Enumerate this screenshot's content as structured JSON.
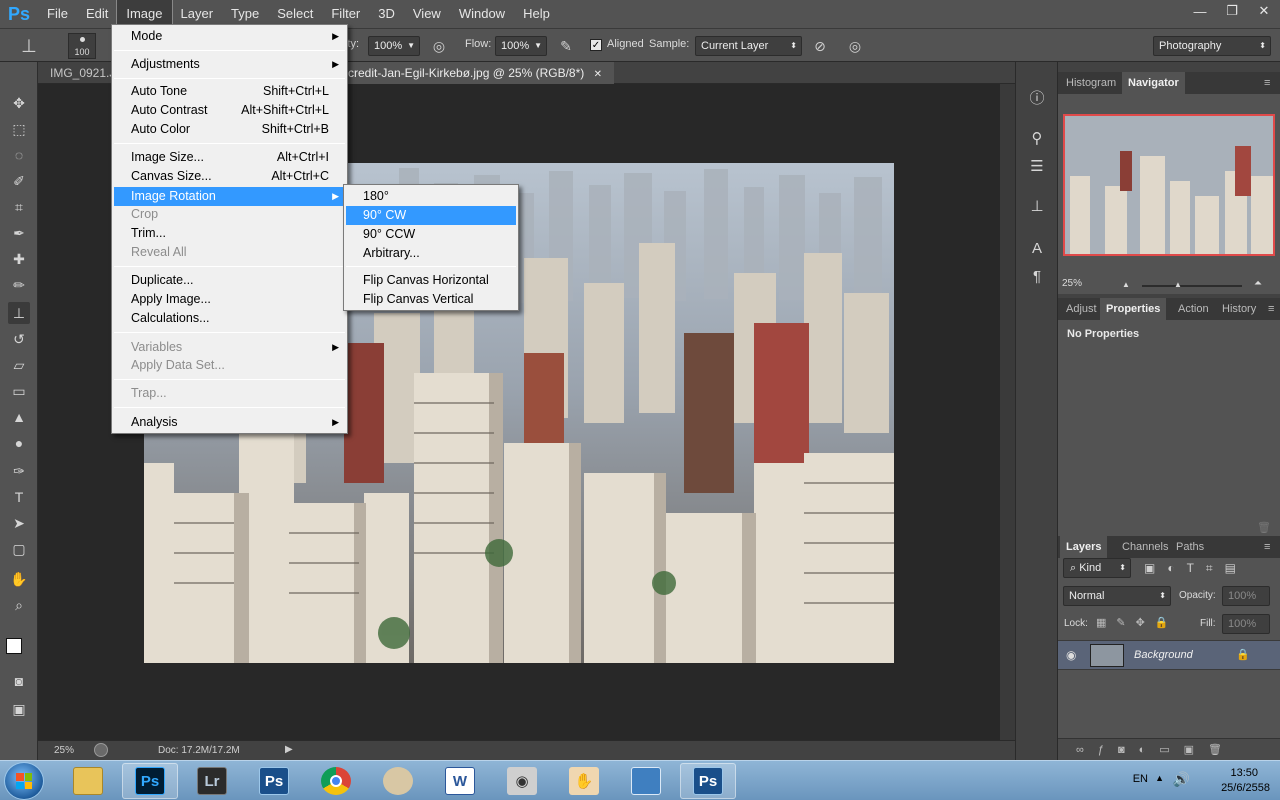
{
  "app": {
    "logo": "Ps"
  },
  "menubar": {
    "items": [
      "File",
      "Edit",
      "Image",
      "Layer",
      "Type",
      "Select",
      "Filter",
      "3D",
      "View",
      "Window",
      "Help"
    ],
    "active": "Image"
  },
  "window_controls": {
    "minimize": "—",
    "restore": "❐",
    "close": "✕"
  },
  "options_bar": {
    "brush_size": "100",
    "opacity_label": "ity:",
    "opacity_value": "100%",
    "flow_label": "Flow:",
    "flow_value": "100%",
    "aligned_label": "Aligned",
    "sample_label": "Sample:",
    "sample_value": "Current Layer",
    "workspace": "Photography"
  },
  "doc_tabs": {
    "tab1": "IMG_0921.J",
    "tab2": "credit-Jan-Egil-Kirkebø.jpg @ 25% (RGB/8*)",
    "tab2_close": "✕"
  },
  "status_bar": {
    "zoom": "25%",
    "doc": "Doc: 17.2M/17.2M"
  },
  "image_menu": {
    "mode": "Mode",
    "adjustments": "Adjustments",
    "auto_tone": "Auto Tone",
    "auto_tone_sc": "Shift+Ctrl+L",
    "auto_contrast": "Auto Contrast",
    "auto_contrast_sc": "Alt+Shift+Ctrl+L",
    "auto_color": "Auto Color",
    "auto_color_sc": "Shift+Ctrl+B",
    "image_size": "Image Size...",
    "image_size_sc": "Alt+Ctrl+I",
    "canvas_size": "Canvas Size...",
    "canvas_size_sc": "Alt+Ctrl+C",
    "image_rotation": "Image Rotation",
    "crop": "Crop",
    "trim": "Trim...",
    "reveal_all": "Reveal All",
    "duplicate": "Duplicate...",
    "apply_image": "Apply Image...",
    "calculations": "Calculations...",
    "variables": "Variables",
    "apply_data_set": "Apply Data Set...",
    "trap": "Trap...",
    "analysis": "Analysis"
  },
  "rotation_menu": {
    "r180": "180°",
    "cw90": "90° CW",
    "ccw90": "90° CCW",
    "arbitrary": "Arbitrary...",
    "flip_h": "Flip Canvas Horizontal",
    "flip_v": "Flip Canvas Vertical"
  },
  "navigator_panel": {
    "tab_histogram": "Histogram",
    "tab_navigator": "Navigator",
    "zoom": "25%"
  },
  "properties_panel": {
    "tab_adjust": "Adjust",
    "tab_properties": "Properties",
    "tab_actions": "Action",
    "tab_history": "History",
    "empty_text": "No Properties"
  },
  "layers_panel": {
    "tab_layers": "Layers",
    "tab_channels": "Channels",
    "tab_paths": "Paths",
    "filter_kind": "Kind",
    "blend_mode": "Normal",
    "opacity_label": "Opacity:",
    "opacity_value": "100%",
    "lock_label": "Lock:",
    "fill_label": "Fill:",
    "fill_value": "100%",
    "layer_name": "Background"
  },
  "taskbar": {
    "apps": [
      "Ps",
      "Lr",
      "Ps",
      "W"
    ],
    "tray": {
      "lang": "EN",
      "time": "13:50",
      "date": "25/6/2558"
    }
  },
  "colors": {
    "accent": "#3399ff",
    "panel": "#535353",
    "canvas_bg": "#282828",
    "ps_blue": "#31a8ff"
  }
}
